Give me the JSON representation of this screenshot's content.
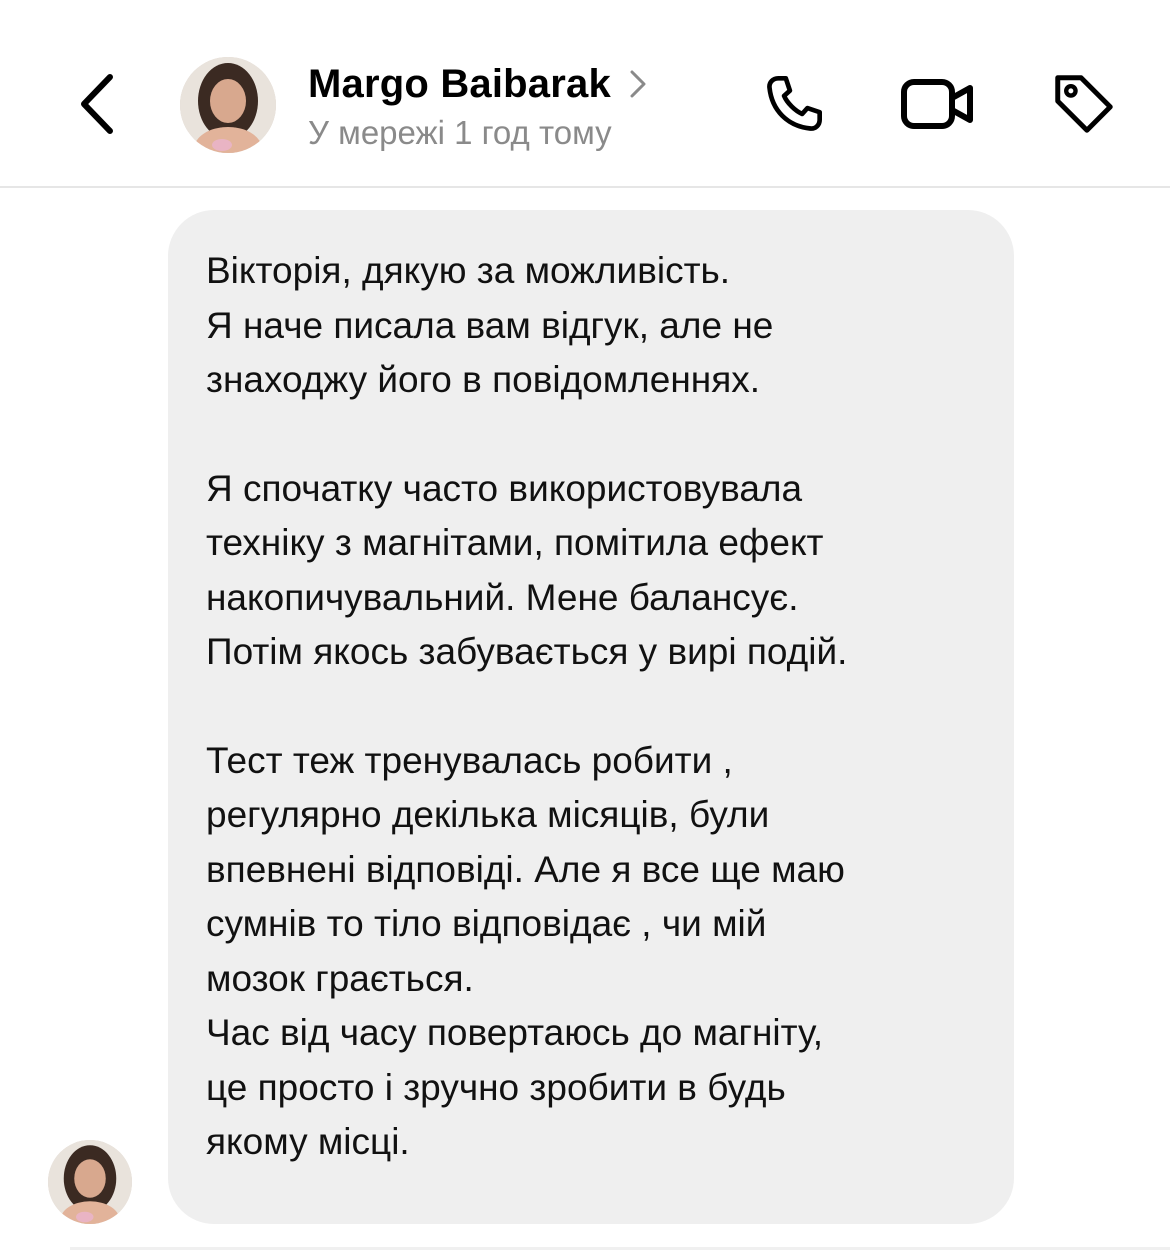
{
  "header": {
    "contact_name": "Margo Baibarak",
    "status": "У мережі 1 год тому",
    "icons": {
      "back": "chevron-left-icon",
      "name_chevron": "chevron-right-icon",
      "phone": "phone-icon",
      "video": "video-camera-icon",
      "tag": "tag-icon"
    }
  },
  "message": {
    "paragraphs": [
      "Вікторія, дякую за можливість.\nЯ наче писала вам відгук, але не\nзнаходжу його в повідомленнях.",
      "Я спочатку часто використовувала\nтехніку з магнітами, помітила ефект\nнакопичувальний. Мене балансує.\nПотім якось забувається у вирі подій.",
      "Тест теж тренувалась робити ,\nрегулярно декілька місяців, були\nвпевнені відповіді. Але я все ще маю\nсумнів то тіло відповідає , чи мій\nмозок грається.\nЧас від часу повертаюсь до магніту,\nце просто і зручно зробити в будь\nякому місці."
    ]
  },
  "colors": {
    "bubble": "#efefef",
    "status_text": "#8a8a8a",
    "divider": "#e6e6e6"
  }
}
